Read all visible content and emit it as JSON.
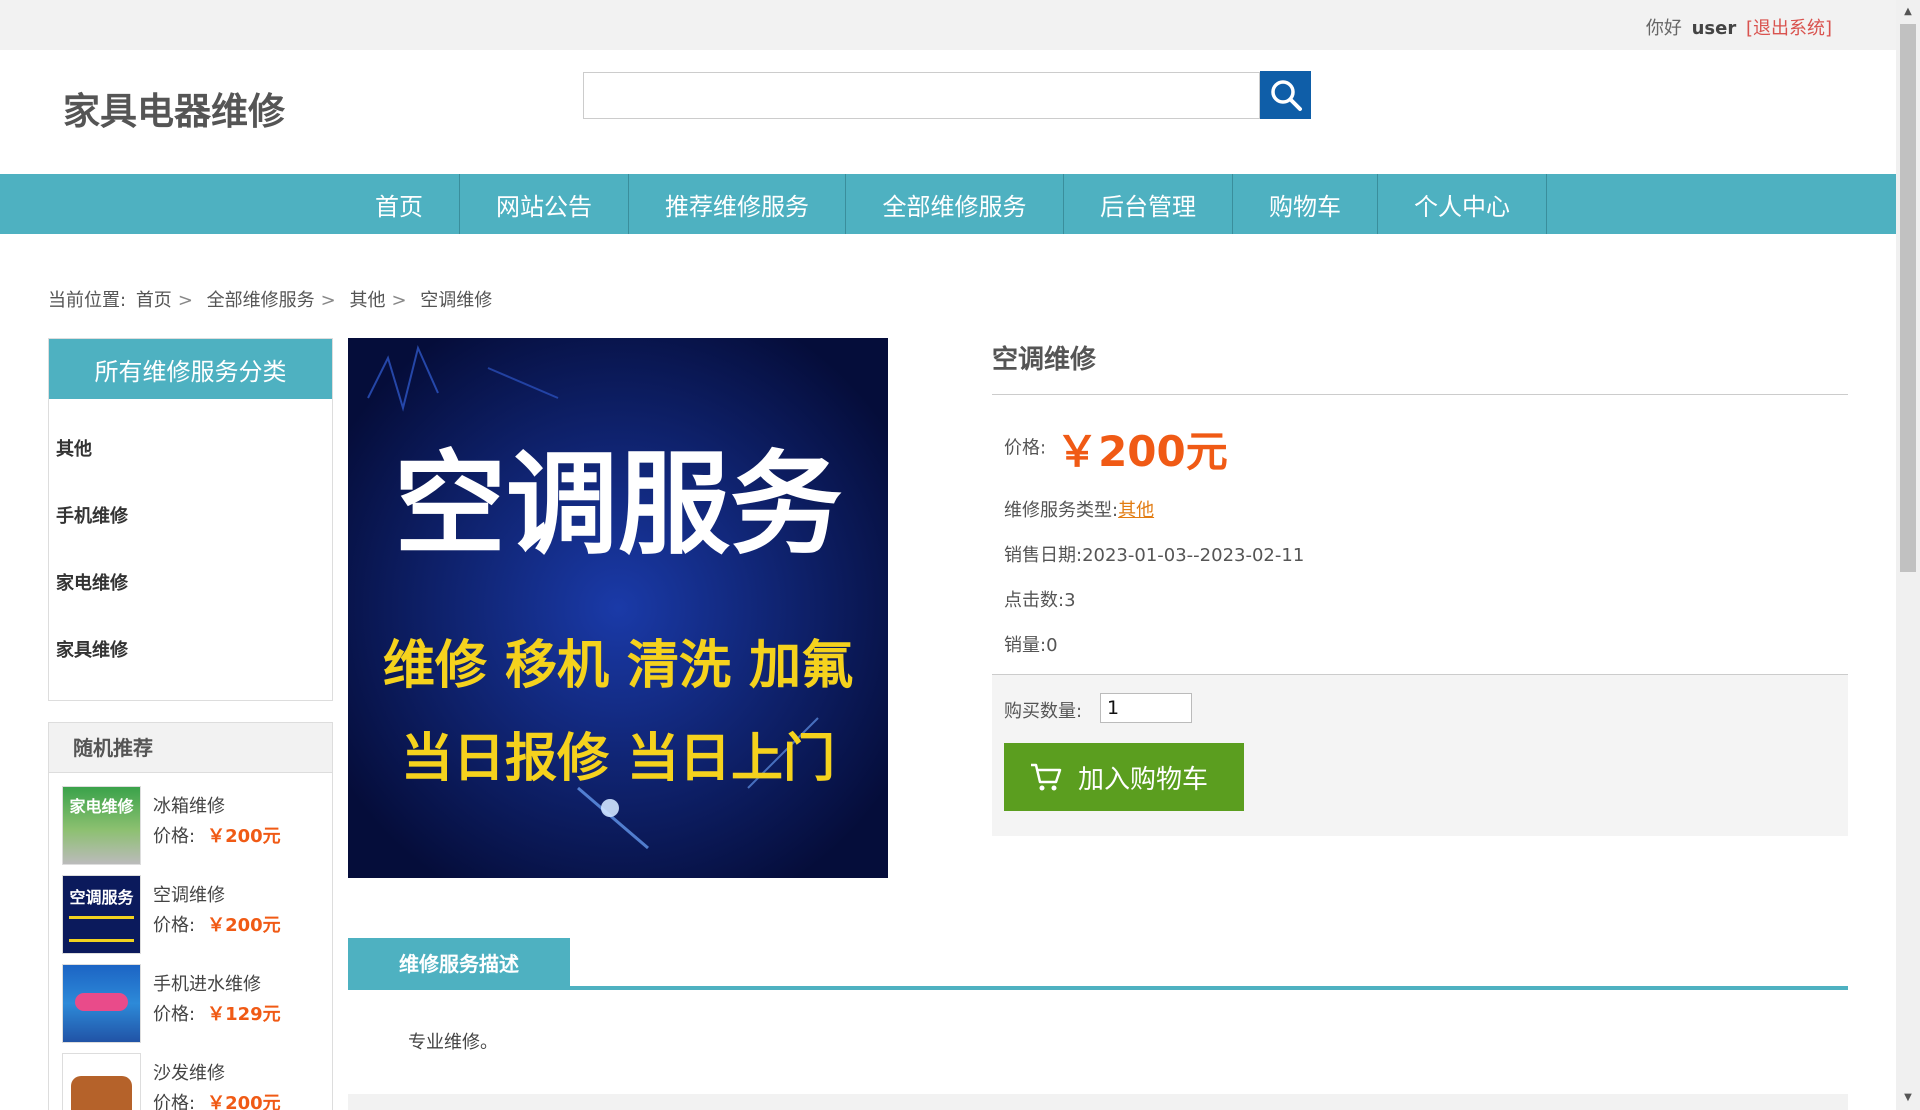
{
  "topbar": {
    "greeting": "你好",
    "username": "user",
    "logout": "[退出系统]"
  },
  "header": {
    "site_title": "家具电器维修",
    "search_placeholder": ""
  },
  "nav": {
    "items": [
      "首页",
      "网站公告",
      "推荐维修服务",
      "全部维修服务",
      "后台管理",
      "购物车",
      "个人中心"
    ]
  },
  "breadcrumb": {
    "prefix": "当前位置:",
    "items": [
      "首页",
      "全部维修服务",
      "其他",
      "空调维修"
    ]
  },
  "categories": {
    "title": "所有维修服务分类",
    "items": [
      "其他",
      "手机维修",
      "家电维修",
      "家具维修"
    ]
  },
  "recommend": {
    "title": "随机推荐",
    "price_label": "价格:",
    "items": [
      {
        "name": "冰箱维修",
        "price": "￥200元",
        "thumb_text": "家电维修"
      },
      {
        "name": "空调维修",
        "price": "￥200元",
        "thumb_text": "空调服务"
      },
      {
        "name": "手机进水维修",
        "price": "￥129元",
        "thumb_text": ""
      },
      {
        "name": "沙发维修",
        "price": "￥200元",
        "thumb_text": ""
      }
    ]
  },
  "image": {
    "line1": "空调服务",
    "line2": "维修 移机 清洗 加氟",
    "line3": "当日报修 当日上门"
  },
  "product": {
    "title": "空调维修",
    "price_label": "价格:",
    "price": "￥200元",
    "type_label": "维修服务类型:",
    "type_value": "其他",
    "date_label": "销售日期:",
    "date_value": "2023-01-03--2023-02-11",
    "clicks_label": "点击数:",
    "clicks_value": "3",
    "sales_label": "销量:",
    "sales_value": "0",
    "qty_label": "购买数量:",
    "qty_value": "1",
    "cart_button": "加入购物车"
  },
  "tabs": {
    "description_tab": "维修服务描述"
  },
  "description": "专业维修。",
  "colors": {
    "teal": "#4eb1c1",
    "orange": "#f05a15",
    "green": "#5b9e1f",
    "search_blue": "#0f5ea8"
  }
}
